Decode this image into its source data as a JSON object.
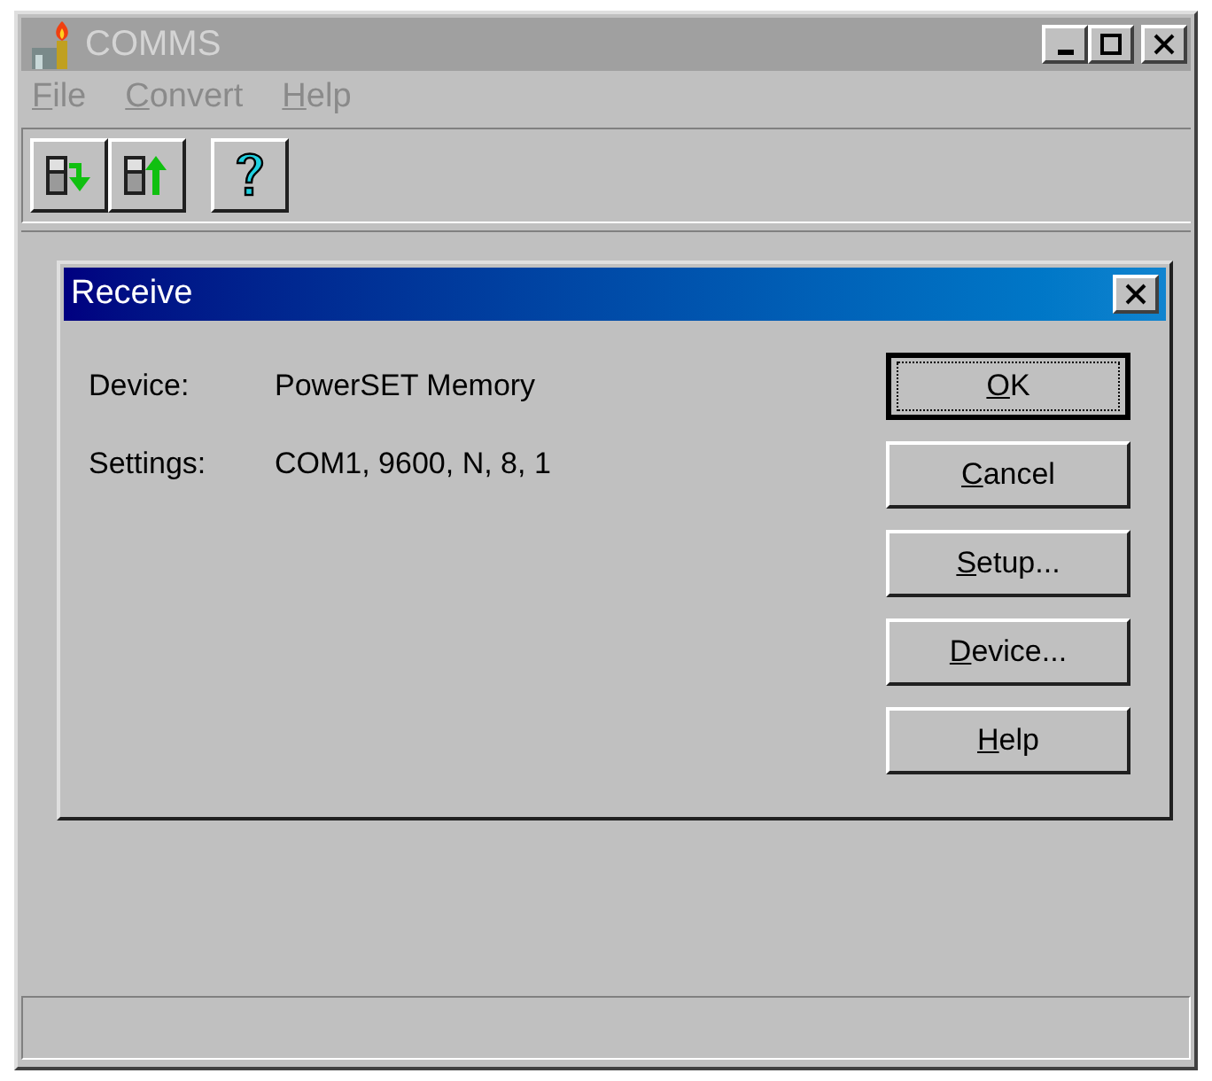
{
  "window": {
    "title": "COMMS",
    "active": false
  },
  "menu": [
    {
      "underlined": "F",
      "text_after": "ile",
      "disabled": true
    },
    {
      "underlined": "C",
      "text_after": "onvert",
      "disabled": true
    },
    {
      "underlined": "H",
      "text_after": "elp",
      "disabled": true
    }
  ],
  "toolbar": [
    {
      "kind": "receive"
    },
    {
      "kind": "send"
    },
    {
      "kind": "separator"
    },
    {
      "kind": "help"
    }
  ],
  "dialog": {
    "title": "Receive",
    "fields": [
      {
        "label": "Device:",
        "value": "PowerSET Memory"
      },
      {
        "label": "Settings:",
        "value": "COM1, 9600, N, 8, 1"
      }
    ],
    "buttons": [
      {
        "underlined": "O",
        "text_after": "K",
        "default": true
      },
      {
        "underlined": "C",
        "text_after": "ancel",
        "default": false
      },
      {
        "underlined": "S",
        "text_after": "etup...",
        "default": false
      },
      {
        "underlined": "D",
        "text_after": "evice...",
        "default": false
      },
      {
        "underlined": "H",
        "text_after": "elp",
        "default": false
      }
    ]
  }
}
